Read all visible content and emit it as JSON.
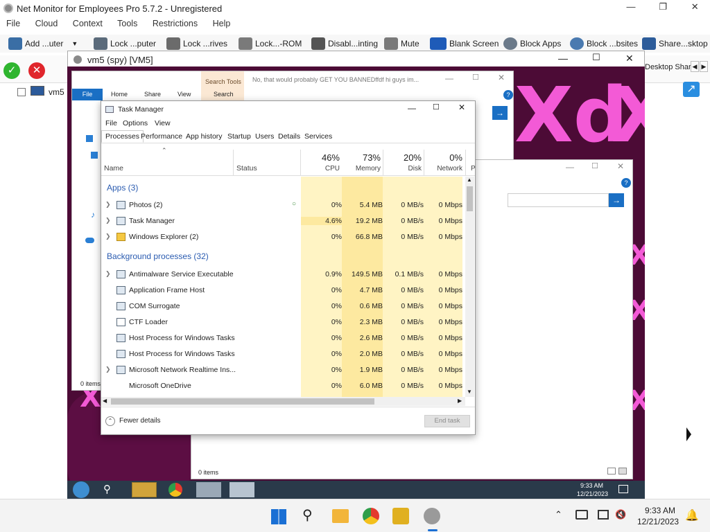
{
  "app": {
    "title": "Net Monitor for Employees Pro 5.7.2 - Unregistered",
    "menu": [
      "File",
      "Cloud",
      "Context",
      "Tools",
      "Restrictions",
      "Help"
    ],
    "toolbar": [
      {
        "label": "Add ...uter",
        "icon": "add-computer-icon",
        "color": "#3a6ea5"
      },
      {
        "label": "Lock ...puter",
        "icon": "lock-computer-icon",
        "color": "#5b6b7b"
      },
      {
        "label": "Lock ...rives",
        "icon": "lock-drives-icon",
        "color": "#6b6b6b"
      },
      {
        "label": "Lock...-ROM",
        "icon": "lock-cdrom-icon",
        "color": "#7a7a7a"
      },
      {
        "label": "Disabl...inting",
        "icon": "disable-printing-icon",
        "color": "#555555"
      },
      {
        "label": "Mute",
        "icon": "mute-icon",
        "color": "#7a7a7a"
      },
      {
        "label": "Blank Screen",
        "icon": "blank-screen-icon",
        "color": "#1e5bb8"
      },
      {
        "label": "Block Apps",
        "icon": "block-apps-icon",
        "color": "#6b7a8a"
      },
      {
        "label": "Block ...bsites",
        "icon": "block-websites-icon",
        "color": "#4a7ab0"
      },
      {
        "label": "Share...sktop",
        "icon": "share-desktop-icon",
        "color": "#2d5c9a"
      }
    ],
    "toolbar2_label": "Desktop Shar",
    "tree_item": "vm5",
    "status_items": "0 items"
  },
  "spy": {
    "title": "vm5 (spy) [VM5]"
  },
  "remote": {
    "explorer": {
      "search_tools": "Search Tools",
      "search_text": "No, that would probably GET YOU BANNEDffdf hi guys im...",
      "tabs": [
        "File",
        "Home",
        "Share",
        "View",
        "Search"
      ],
      "items_count": "0 items",
      "bottom_items": "0 items"
    },
    "taskmanager": {
      "title": "Task Manager",
      "menu": [
        "File",
        "Options",
        "View"
      ],
      "tabs": [
        "Processes",
        "Performance",
        "App history",
        "Startup",
        "Users",
        "Details",
        "Services"
      ],
      "col_name": "Name",
      "col_status": "Status",
      "cpu_pct": "46%",
      "cpu_label": "CPU",
      "mem_pct": "73%",
      "mem_label": "Memory",
      "disk_pct": "20%",
      "disk_label": "Disk",
      "net_pct": "0%",
      "net_label": "Network",
      "col_p": "P",
      "group_apps": "Apps (3)",
      "group_bg": "Background processes (32)",
      "apps": [
        {
          "name": "Photos (2)",
          "cpu": "0%",
          "mem": "5.4 MB",
          "disk": "0 MB/s",
          "net": "0 Mbps"
        },
        {
          "name": "Task Manager",
          "cpu": "4.6%",
          "mem": "19.2 MB",
          "disk": "0 MB/s",
          "net": "0 Mbps"
        },
        {
          "name": "Windows Explorer (2)",
          "cpu": "0%",
          "mem": "66.8 MB",
          "disk": "0 MB/s",
          "net": "0 Mbps"
        }
      ],
      "bg": [
        {
          "name": "Antimalware Service Executable",
          "cpu": "0.9%",
          "mem": "149.5 MB",
          "disk": "0.1 MB/s",
          "net": "0 Mbps"
        },
        {
          "name": "Application Frame Host",
          "cpu": "0%",
          "mem": "4.7 MB",
          "disk": "0 MB/s",
          "net": "0 Mbps"
        },
        {
          "name": "COM Surrogate",
          "cpu": "0%",
          "mem": "0.6 MB",
          "disk": "0 MB/s",
          "net": "0 Mbps"
        },
        {
          "name": "CTF Loader",
          "cpu": "0%",
          "mem": "2.3 MB",
          "disk": "0 MB/s",
          "net": "0 Mbps"
        },
        {
          "name": "Host Process for Windows Tasks",
          "cpu": "0%",
          "mem": "2.6 MB",
          "disk": "0 MB/s",
          "net": "0 Mbps"
        },
        {
          "name": "Host Process for Windows Tasks",
          "cpu": "0%",
          "mem": "2.0 MB",
          "disk": "0 MB/s",
          "net": "0 Mbps"
        },
        {
          "name": "Microsoft Network Realtime Ins...",
          "cpu": "0%",
          "mem": "1.9 MB",
          "disk": "0 MB/s",
          "net": "0 Mbps"
        },
        {
          "name": "Microsoft OneDrive",
          "cpu": "0%",
          "mem": "6.0 MB",
          "disk": "0 MB/s",
          "net": "0 Mbps"
        }
      ],
      "fewer_details": "Fewer details",
      "end_task": "End task"
    },
    "taskbar": {
      "time": "9:33 AM",
      "date": "12/21/2023"
    }
  },
  "host_taskbar": {
    "time": "9:33 AM",
    "date": "12/21/2023"
  }
}
